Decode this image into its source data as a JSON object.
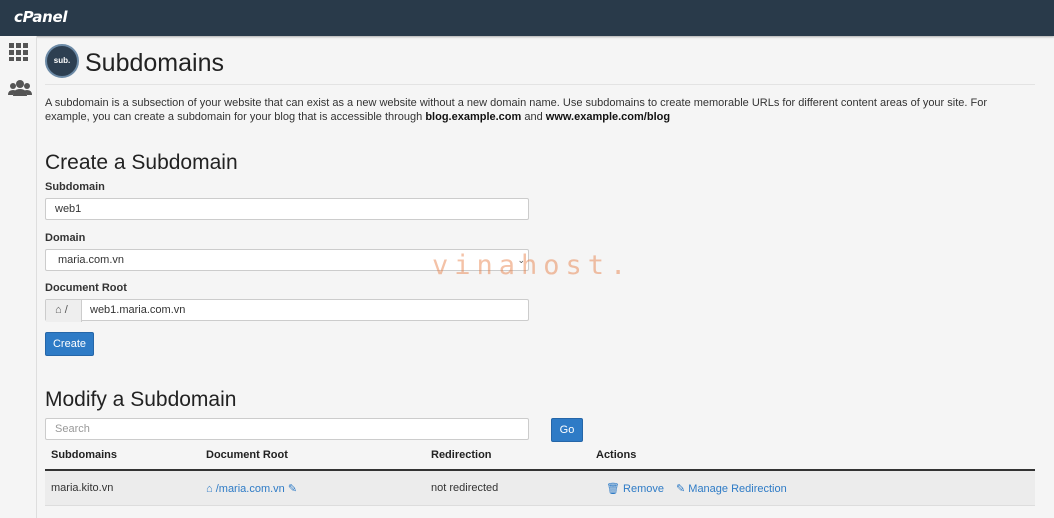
{
  "brand": {
    "logo_text": "cPanel"
  },
  "sidebar": {
    "items": [
      {
        "icon": "grid-icon"
      },
      {
        "icon": "users-icon"
      }
    ]
  },
  "page": {
    "badge_text": "sub.",
    "title": "Subdomains",
    "intro_part1": "A subdomain is a subsection of your website that can exist as a new website without a new domain name. Use subdomains to create memorable URLs for different content areas of your site. For example, you can create a subdomain for your blog that is accessible through ",
    "intro_example1": "blog.example.com",
    "intro_and": " and ",
    "intro_example2": "www.example.com/blog"
  },
  "create": {
    "heading": "Create a Subdomain",
    "subdomain_label": "Subdomain",
    "subdomain_value": "web1",
    "domain_label": "Domain",
    "domain_value": "maria.com.vn",
    "docroot_label": "Document Root",
    "docroot_prefix": "/",
    "docroot_value": "web1.maria.com.vn",
    "create_button": "Create"
  },
  "modify": {
    "heading": "Modify a Subdomain",
    "search_placeholder": "Search",
    "go_button": "Go",
    "columns": [
      "Subdomains",
      "Document Root",
      "Redirection",
      "Actions"
    ],
    "rows": [
      {
        "subdomain": "maria.kito.vn",
        "document_root": "/maria.com.vn",
        "redirection": "not redirected",
        "remove_label": "Remove",
        "manage_label": "Manage Redirection"
      }
    ]
  },
  "watermark": {
    "text": "vinahost."
  },
  "colors": {
    "topbar": "#293a4a",
    "accent": "#2e7bc6",
    "background": "#f5f5f5"
  }
}
